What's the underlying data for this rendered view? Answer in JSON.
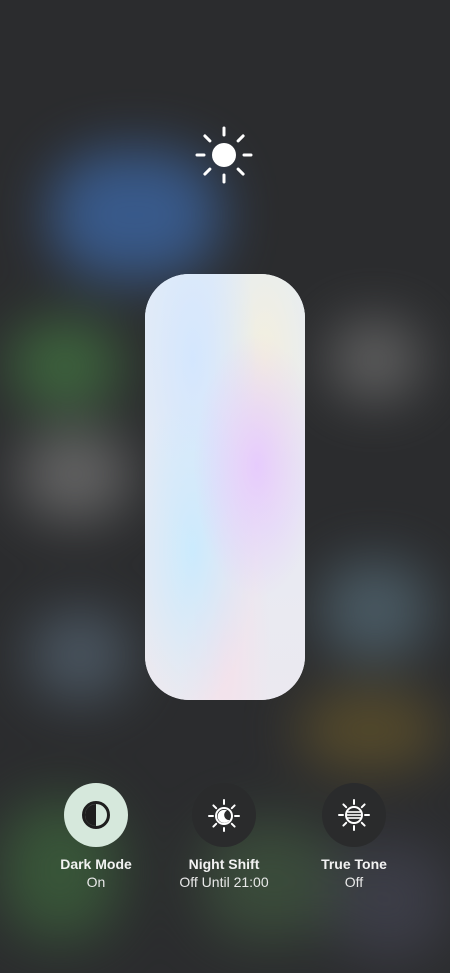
{
  "colors": {
    "slider_fill": "#e8edf5",
    "toggle_on": "#d6e8dc",
    "toggle_off": "#2a2b2c",
    "icon_on": "#1e1e1e",
    "icon_off": "#ffffff",
    "text": "#f2f2f2"
  },
  "brightness": {
    "level": 1.0,
    "icon": "sun-icon"
  },
  "toggles": [
    {
      "label": "Dark Mode",
      "status": "On",
      "state": "on",
      "icon": "dark-mode-icon"
    },
    {
      "label": "Night Shift",
      "status": "Off Until 21:00",
      "state": "off",
      "icon": "night-shift-icon"
    },
    {
      "label": "True Tone",
      "status": "Off",
      "state": "off",
      "icon": "true-tone-icon"
    }
  ]
}
